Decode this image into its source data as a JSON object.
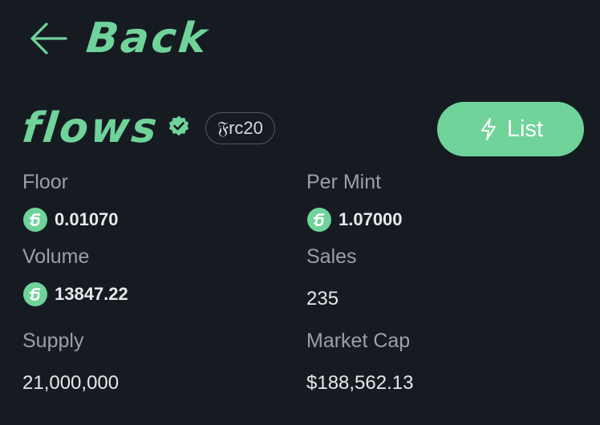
{
  "header": {
    "back_label": "Back"
  },
  "token": {
    "name": "flows",
    "badge": "𝔉rc20",
    "list_button": "List"
  },
  "stats": {
    "floor": {
      "label": "Floor",
      "value": "0.01070"
    },
    "per_mint": {
      "label": "Per Mint",
      "value": "1.07000"
    },
    "volume": {
      "label": "Volume",
      "value": "13847.22"
    },
    "sales": {
      "label": "Sales",
      "value": "235"
    },
    "supply": {
      "label": "Supply",
      "value": "21,000,000"
    },
    "market_cap": {
      "label": "Market Cap",
      "value": "$188,562.13"
    }
  },
  "colors": {
    "accent": "#6fd39a",
    "background": "#161b22",
    "muted_text": "#9aa0a6",
    "text": "#e6e8ea"
  },
  "icons": {
    "back": "arrow-left-icon",
    "verified": "verified-badge-icon",
    "list": "lightning-bolt-icon",
    "currency": "flow-coin-icon"
  }
}
